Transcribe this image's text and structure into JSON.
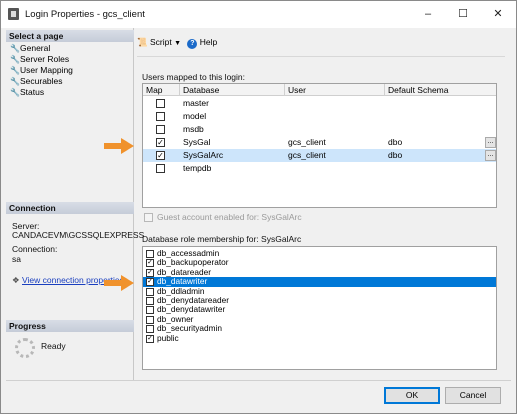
{
  "window": {
    "title": "Login Properties - gcs_client",
    "controls": {
      "minimize": "–",
      "maximize": "☐",
      "close": "✕"
    }
  },
  "sidebar": {
    "select_page_header": "Select a page",
    "pages": [
      {
        "label": "General",
        "icon": "wrench-icon"
      },
      {
        "label": "Server Roles",
        "icon": "wrench-icon"
      },
      {
        "label": "User Mapping",
        "icon": "wrench-icon"
      },
      {
        "label": "Securables",
        "icon": "wrench-icon"
      },
      {
        "label": "Status",
        "icon": "wrench-icon"
      }
    ],
    "connection_header": "Connection",
    "server_label": "Server:",
    "server_value": "CANDACEVM\\GCSSQLEXPRESS",
    "connection_label": "Connection:",
    "connection_value": "sa",
    "view_link": "View connection properties",
    "progress_header": "Progress",
    "progress_status": "Ready"
  },
  "toolbar": {
    "script_label": "Script",
    "help_label": "Help"
  },
  "users_section": {
    "label": "Users mapped to this login:",
    "columns": [
      "Map",
      "Database",
      "User",
      "Default Schema"
    ],
    "rows": [
      {
        "mapped": false,
        "database": "master",
        "user": "",
        "schema": ""
      },
      {
        "mapped": false,
        "database": "model",
        "user": "",
        "schema": ""
      },
      {
        "mapped": false,
        "database": "msdb",
        "user": "",
        "schema": ""
      },
      {
        "mapped": true,
        "database": "SysGal",
        "user": "gcs_client",
        "schema": "dbo",
        "ellipsis": "..."
      },
      {
        "mapped": true,
        "database": "SysGalArc",
        "user": "gcs_client",
        "schema": "dbo",
        "ellipsis": "...",
        "selected": true
      },
      {
        "mapped": false,
        "database": "tempdb",
        "user": "",
        "schema": ""
      }
    ]
  },
  "guest_account": {
    "label": "Guest account enabled for: SysGalArc",
    "enabled": false
  },
  "roles_section": {
    "label": "Database role membership for: SysGalArc",
    "roles": [
      {
        "name": "db_accessadmin",
        "checked": false
      },
      {
        "name": "db_backupoperator",
        "checked": true
      },
      {
        "name": "db_datareader",
        "checked": true
      },
      {
        "name": "db_datawriter",
        "checked": true,
        "selected": true
      },
      {
        "name": "db_ddladmin",
        "checked": false
      },
      {
        "name": "db_denydatareader",
        "checked": false
      },
      {
        "name": "db_denydatawriter",
        "checked": false
      },
      {
        "name": "db_owner",
        "checked": false
      },
      {
        "name": "db_securityadmin",
        "checked": false
      },
      {
        "name": "public",
        "checked": true
      }
    ]
  },
  "buttons": {
    "ok": "OK",
    "cancel": "Cancel"
  },
  "colors": {
    "highlight_arrow": "#f0922c",
    "selected_row": "#0078d7",
    "selected_grid_row": "#cde5fb"
  }
}
